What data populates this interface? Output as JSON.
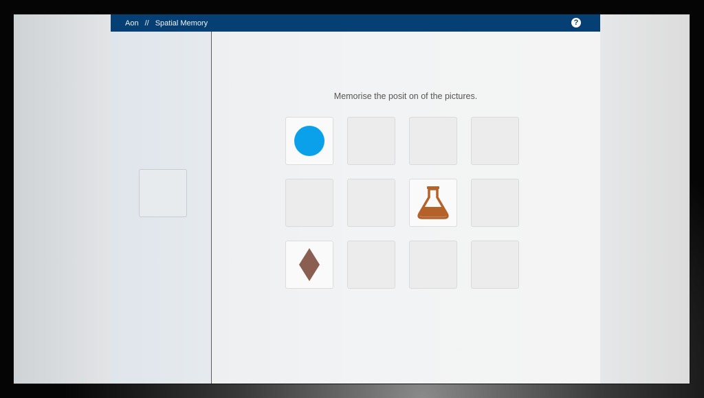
{
  "header": {
    "app_name": "Aon",
    "separator": "//",
    "module_name": "Spatial Memory",
    "help_icon": "question-circle-icon"
  },
  "instruction": "Memorise the posit on of the pictures.",
  "colors": {
    "header_bg": "#063f73",
    "circle": "#0aa0ea",
    "flask": "#b5622a",
    "diamond": "#8b5e52"
  },
  "grid": {
    "rows": 3,
    "columns": 4,
    "cells": [
      {
        "shape": "circle-icon"
      },
      {
        "shape": ""
      },
      {
        "shape": ""
      },
      {
        "shape": ""
      },
      {
        "shape": ""
      },
      {
        "shape": ""
      },
      {
        "shape": "flask-icon"
      },
      {
        "shape": ""
      },
      {
        "shape": "diamond-icon"
      },
      {
        "shape": ""
      },
      {
        "shape": ""
      },
      {
        "shape": ""
      }
    ]
  }
}
